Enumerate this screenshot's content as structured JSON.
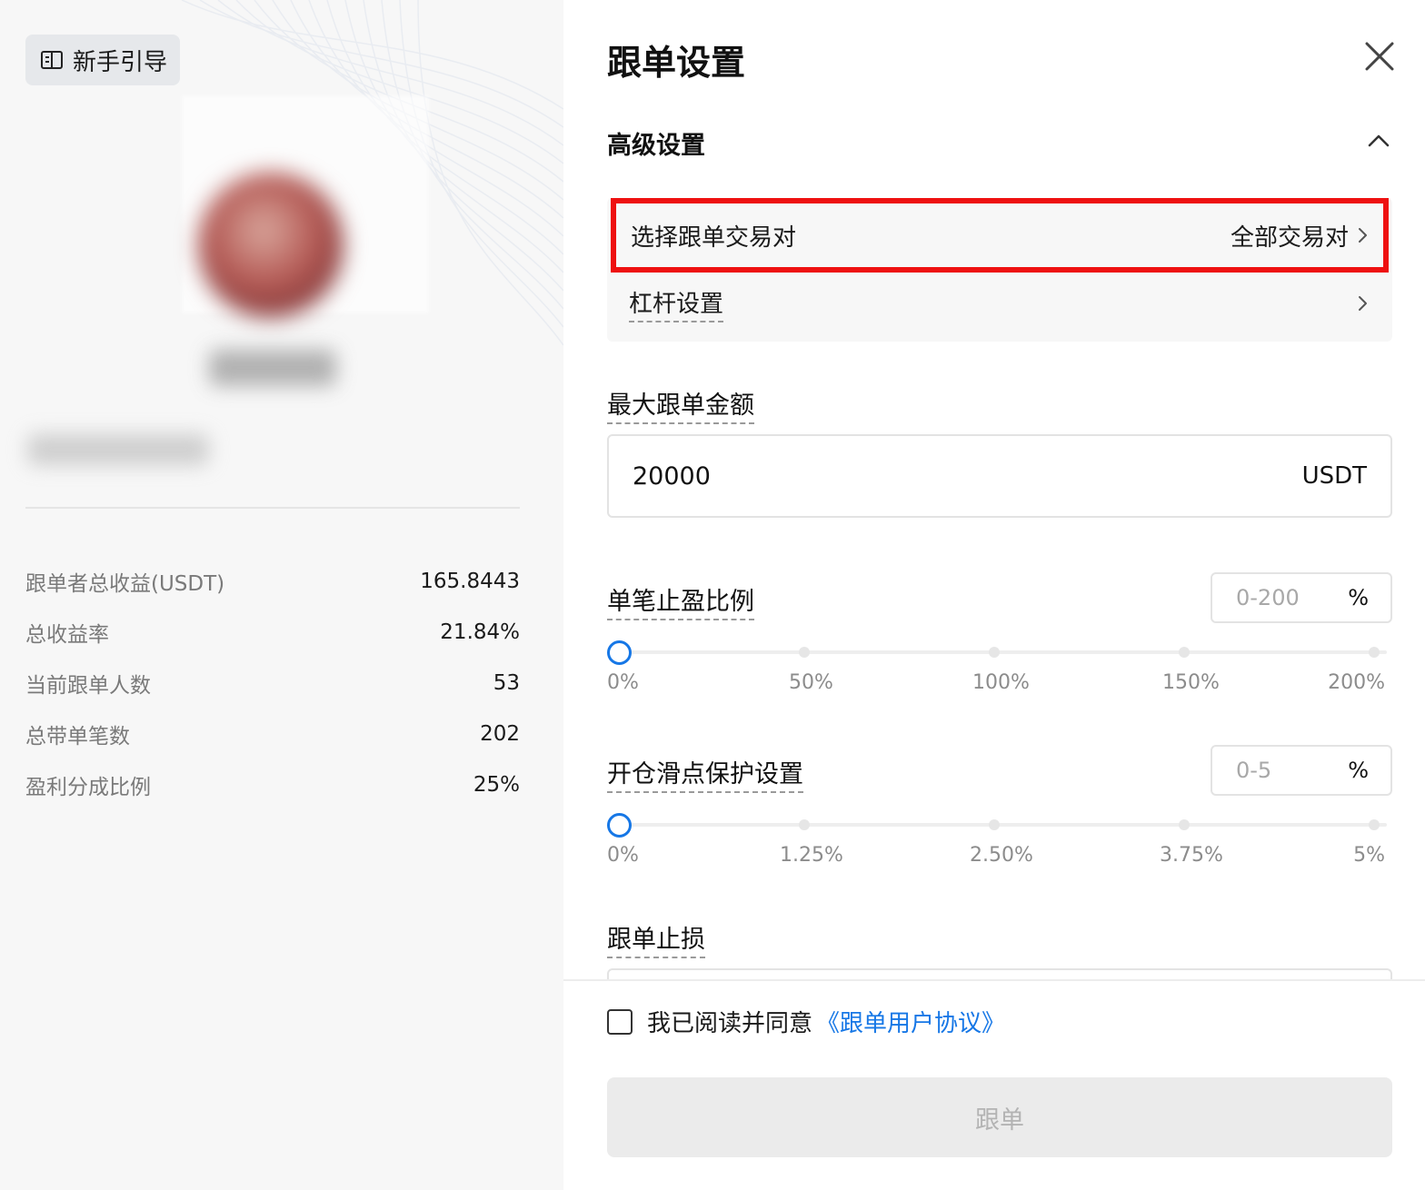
{
  "left": {
    "guide_label": "新手引导",
    "stats": [
      {
        "label": "跟单者总收益(USDT)",
        "value": "165.8443"
      },
      {
        "label": "总收益率",
        "value": "21.84%"
      },
      {
        "label": "当前跟单人数",
        "value": "53"
      },
      {
        "label": "总带单笔数",
        "value": "202"
      },
      {
        "label": "盈利分成比例",
        "value": "25%"
      }
    ]
  },
  "panel": {
    "title": "跟单设置",
    "advanced": {
      "title": "高级设置",
      "pairs_label": "选择跟单交易对",
      "pairs_value": "全部交易对",
      "leverage_label": "杠杆设置"
    },
    "max_amount": {
      "label": "最大跟单金额",
      "value": "20000",
      "unit": "USDT"
    },
    "take_profit": {
      "label": "单笔止盈比例",
      "placeholder": "0-200",
      "unit": "%",
      "ticks": [
        "0%",
        "50%",
        "100%",
        "150%",
        "200%"
      ],
      "value": 0
    },
    "slippage": {
      "label": "开仓滑点保护设置",
      "placeholder": "0-5",
      "unit": "%",
      "ticks": [
        "0%",
        "1.25%",
        "2.50%",
        "3.75%",
        "5%"
      ],
      "value": 0
    },
    "stop_loss": {
      "label": "跟单止损"
    },
    "agreement": {
      "text": "我已阅读并同意",
      "link": "《跟单用户协议》",
      "checked": false
    },
    "submit_label": "跟单"
  },
  "colors": {
    "accent": "#1677e6",
    "highlight_border": "#ee1111",
    "disabled_button": "#ebebeb"
  }
}
